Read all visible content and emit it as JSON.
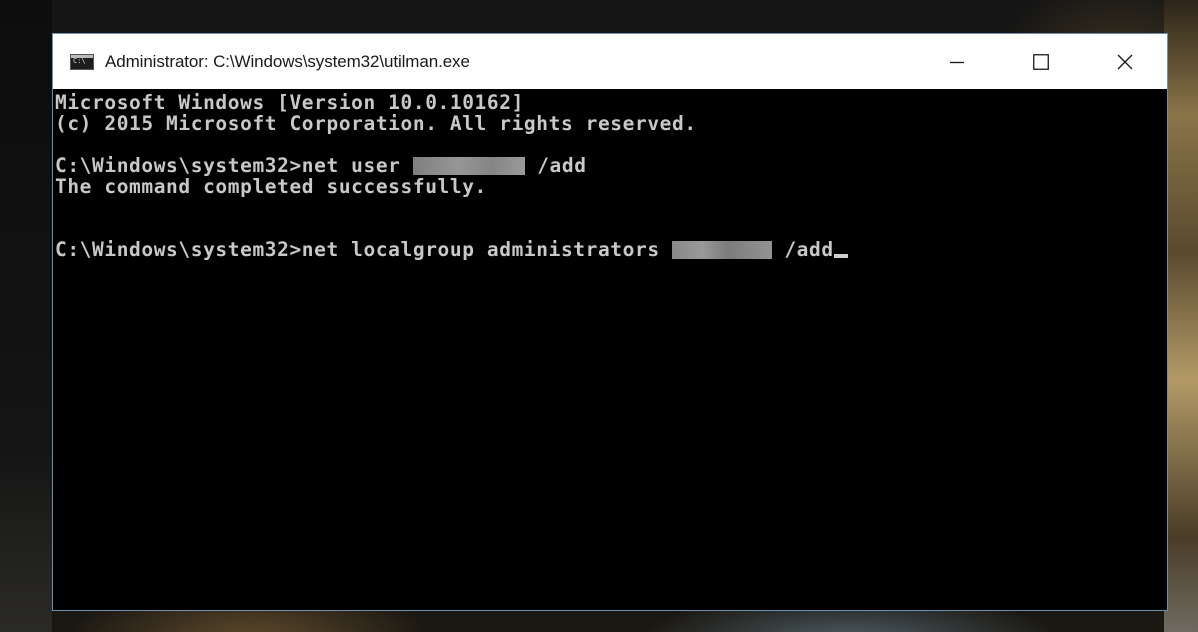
{
  "window": {
    "title": "Administrator: C:\\Windows\\system32\\utilman.exe",
    "icon": "cmd-console-icon",
    "icon_glyph": "C:\\"
  },
  "controls": {
    "minimize": "minimize-icon",
    "maximize": "maximize-icon",
    "close": "close-icon"
  },
  "console": {
    "line1": "Microsoft Windows [Version 10.0.10162]",
    "line2": "(c) 2015 Microsoft Corporation. All rights reserved.",
    "cmd1_prefix": "C:\\Windows\\system32>net user ",
    "cmd1_suffix": " /add",
    "cmd1_output": "The command completed successfully.",
    "cmd2_prefix": "C:\\Windows\\system32>net localgroup administrators ",
    "cmd2_suffix": " /add",
    "text_color": "#c8c8c8",
    "background": "#000000"
  }
}
